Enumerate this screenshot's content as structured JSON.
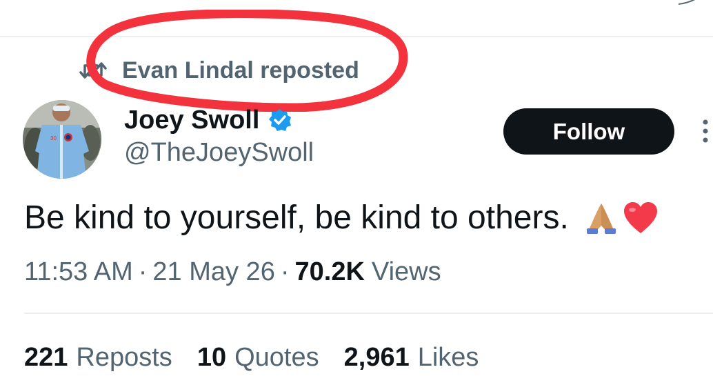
{
  "repost": {
    "icon": "repost-icon",
    "text": "Evan Lindal reposted"
  },
  "author": {
    "display_name": "Joey Swoll",
    "verified_icon": "verified-badge-icon",
    "handle": "@TheJoeySwoll"
  },
  "follow": {
    "label": "Follow"
  },
  "tweet": {
    "text": "Be kind to yourself, be kind to others.",
    "emojis": [
      "folded-hands-emoji",
      "red-heart-emoji"
    ]
  },
  "meta": {
    "time": "11:53 AM",
    "separator": "·",
    "date": "21 May 26",
    "views_count": "70.2K",
    "views_label": "Views"
  },
  "stats": [
    {
      "count": "221",
      "label": "Reposts"
    },
    {
      "count": "10",
      "label": "Quotes"
    },
    {
      "count": "2,961",
      "label": "Likes"
    }
  ],
  "colors": {
    "text_primary": "#0f1419",
    "text_secondary": "#536471",
    "verified_blue": "#1d9bf0",
    "highlight_red": "#f2333e",
    "button_dark": "#0f1419"
  }
}
